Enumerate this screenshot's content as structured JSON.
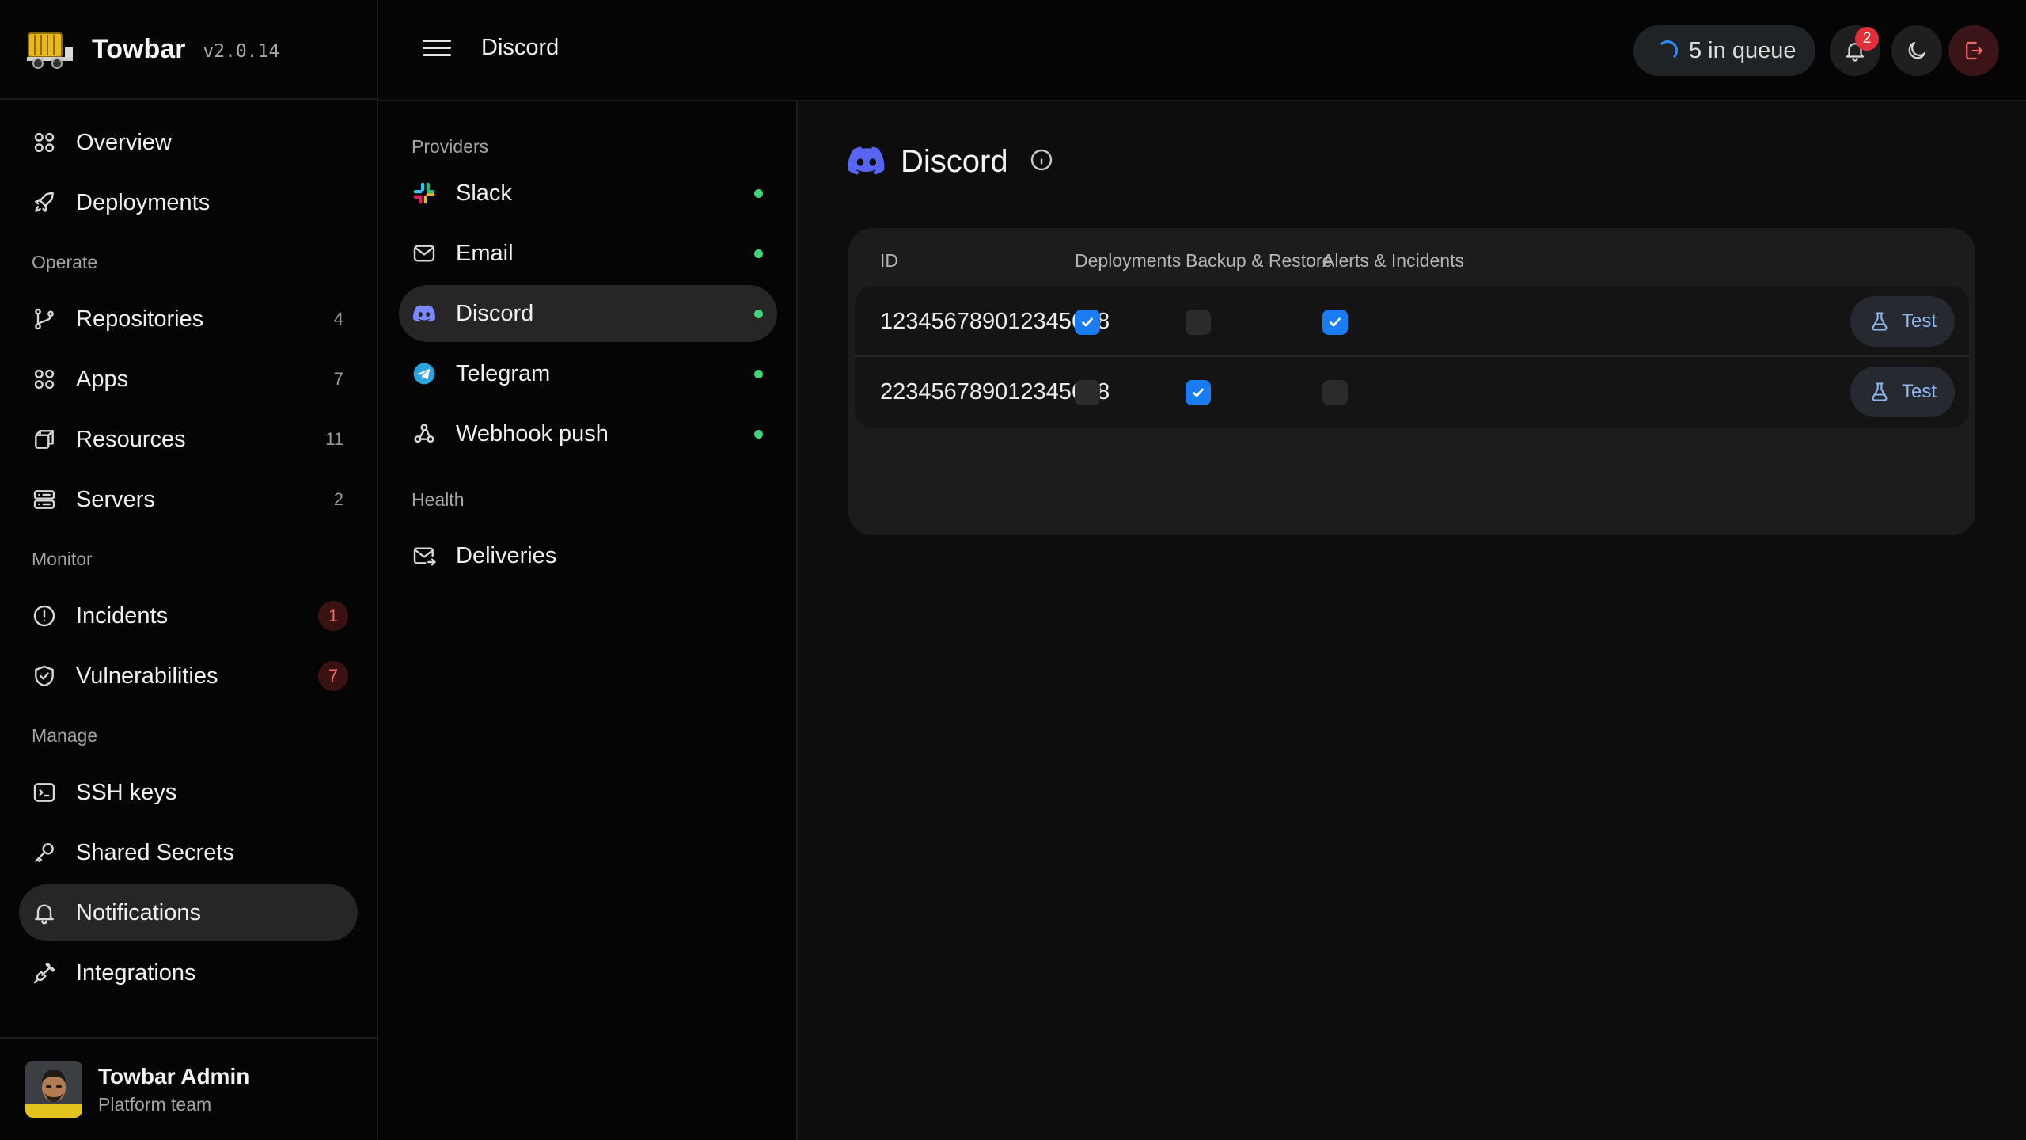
{
  "app": {
    "name": "Towbar",
    "version": "v2.0.14"
  },
  "colors": {
    "accent": "#1a7cf2",
    "discord": "#5865f2",
    "status_ok": "#3fd37a",
    "danger": "#e0303a"
  },
  "sidebar": {
    "top_items": [
      {
        "label": "Overview",
        "icon": "grid-icon"
      },
      {
        "label": "Deployments",
        "icon": "rocket-icon"
      }
    ],
    "sections": {
      "operate": "Operate",
      "monitor": "Monitor",
      "manage": "Manage"
    },
    "operate_items": [
      {
        "label": "Repositories",
        "count": "4",
        "icon": "git-branch-icon"
      },
      {
        "label": "Apps",
        "count": "7",
        "icon": "grid-icon"
      },
      {
        "label": "Resources",
        "count": "11",
        "icon": "box-icon"
      },
      {
        "label": "Servers",
        "count": "2",
        "icon": "server-icon"
      }
    ],
    "monitor_items": [
      {
        "label": "Incidents",
        "badge": "1",
        "icon": "alert-circle-icon"
      },
      {
        "label": "Vulnerabilities",
        "badge": "7",
        "icon": "shield-icon"
      }
    ],
    "manage_items": [
      {
        "label": "SSH keys",
        "icon": "terminal-icon"
      },
      {
        "label": "Shared Secrets",
        "icon": "key-icon"
      },
      {
        "label": "Notifications",
        "icon": "bell-icon",
        "active": true
      },
      {
        "label": "Integrations",
        "icon": "plug-icon"
      }
    ],
    "user": {
      "name": "Towbar Admin",
      "team": "Platform team"
    }
  },
  "topbar": {
    "title": "Discord",
    "queue": "5 in queue",
    "notifications_count": "2"
  },
  "providers": {
    "section_providers": "Providers",
    "section_health": "Health",
    "items": [
      {
        "label": "Slack",
        "icon": "slack-icon",
        "status": "connected"
      },
      {
        "label": "Email",
        "icon": "mail-icon",
        "status": "connected"
      },
      {
        "label": "Discord",
        "icon": "discord-icon",
        "status": "connected",
        "active": true
      },
      {
        "label": "Telegram",
        "icon": "telegram-icon",
        "status": "connected"
      },
      {
        "label": "Webhook push",
        "icon": "webhook-icon",
        "status": "connected"
      }
    ],
    "health_items": [
      {
        "label": "Deliveries",
        "icon": "mail-send-icon"
      }
    ]
  },
  "main": {
    "title": "Discord",
    "table": {
      "columns": [
        "ID",
        "Deployments",
        "Backup & Restore",
        "Alerts & Incidents"
      ],
      "rows": [
        {
          "id": "123456789012345678",
          "deployments": true,
          "backup_restore": false,
          "alerts_incidents": true,
          "action": "Test"
        },
        {
          "id": "223456789012345678",
          "deployments": false,
          "backup_restore": true,
          "alerts_incidents": false,
          "action": "Test"
        }
      ]
    }
  }
}
